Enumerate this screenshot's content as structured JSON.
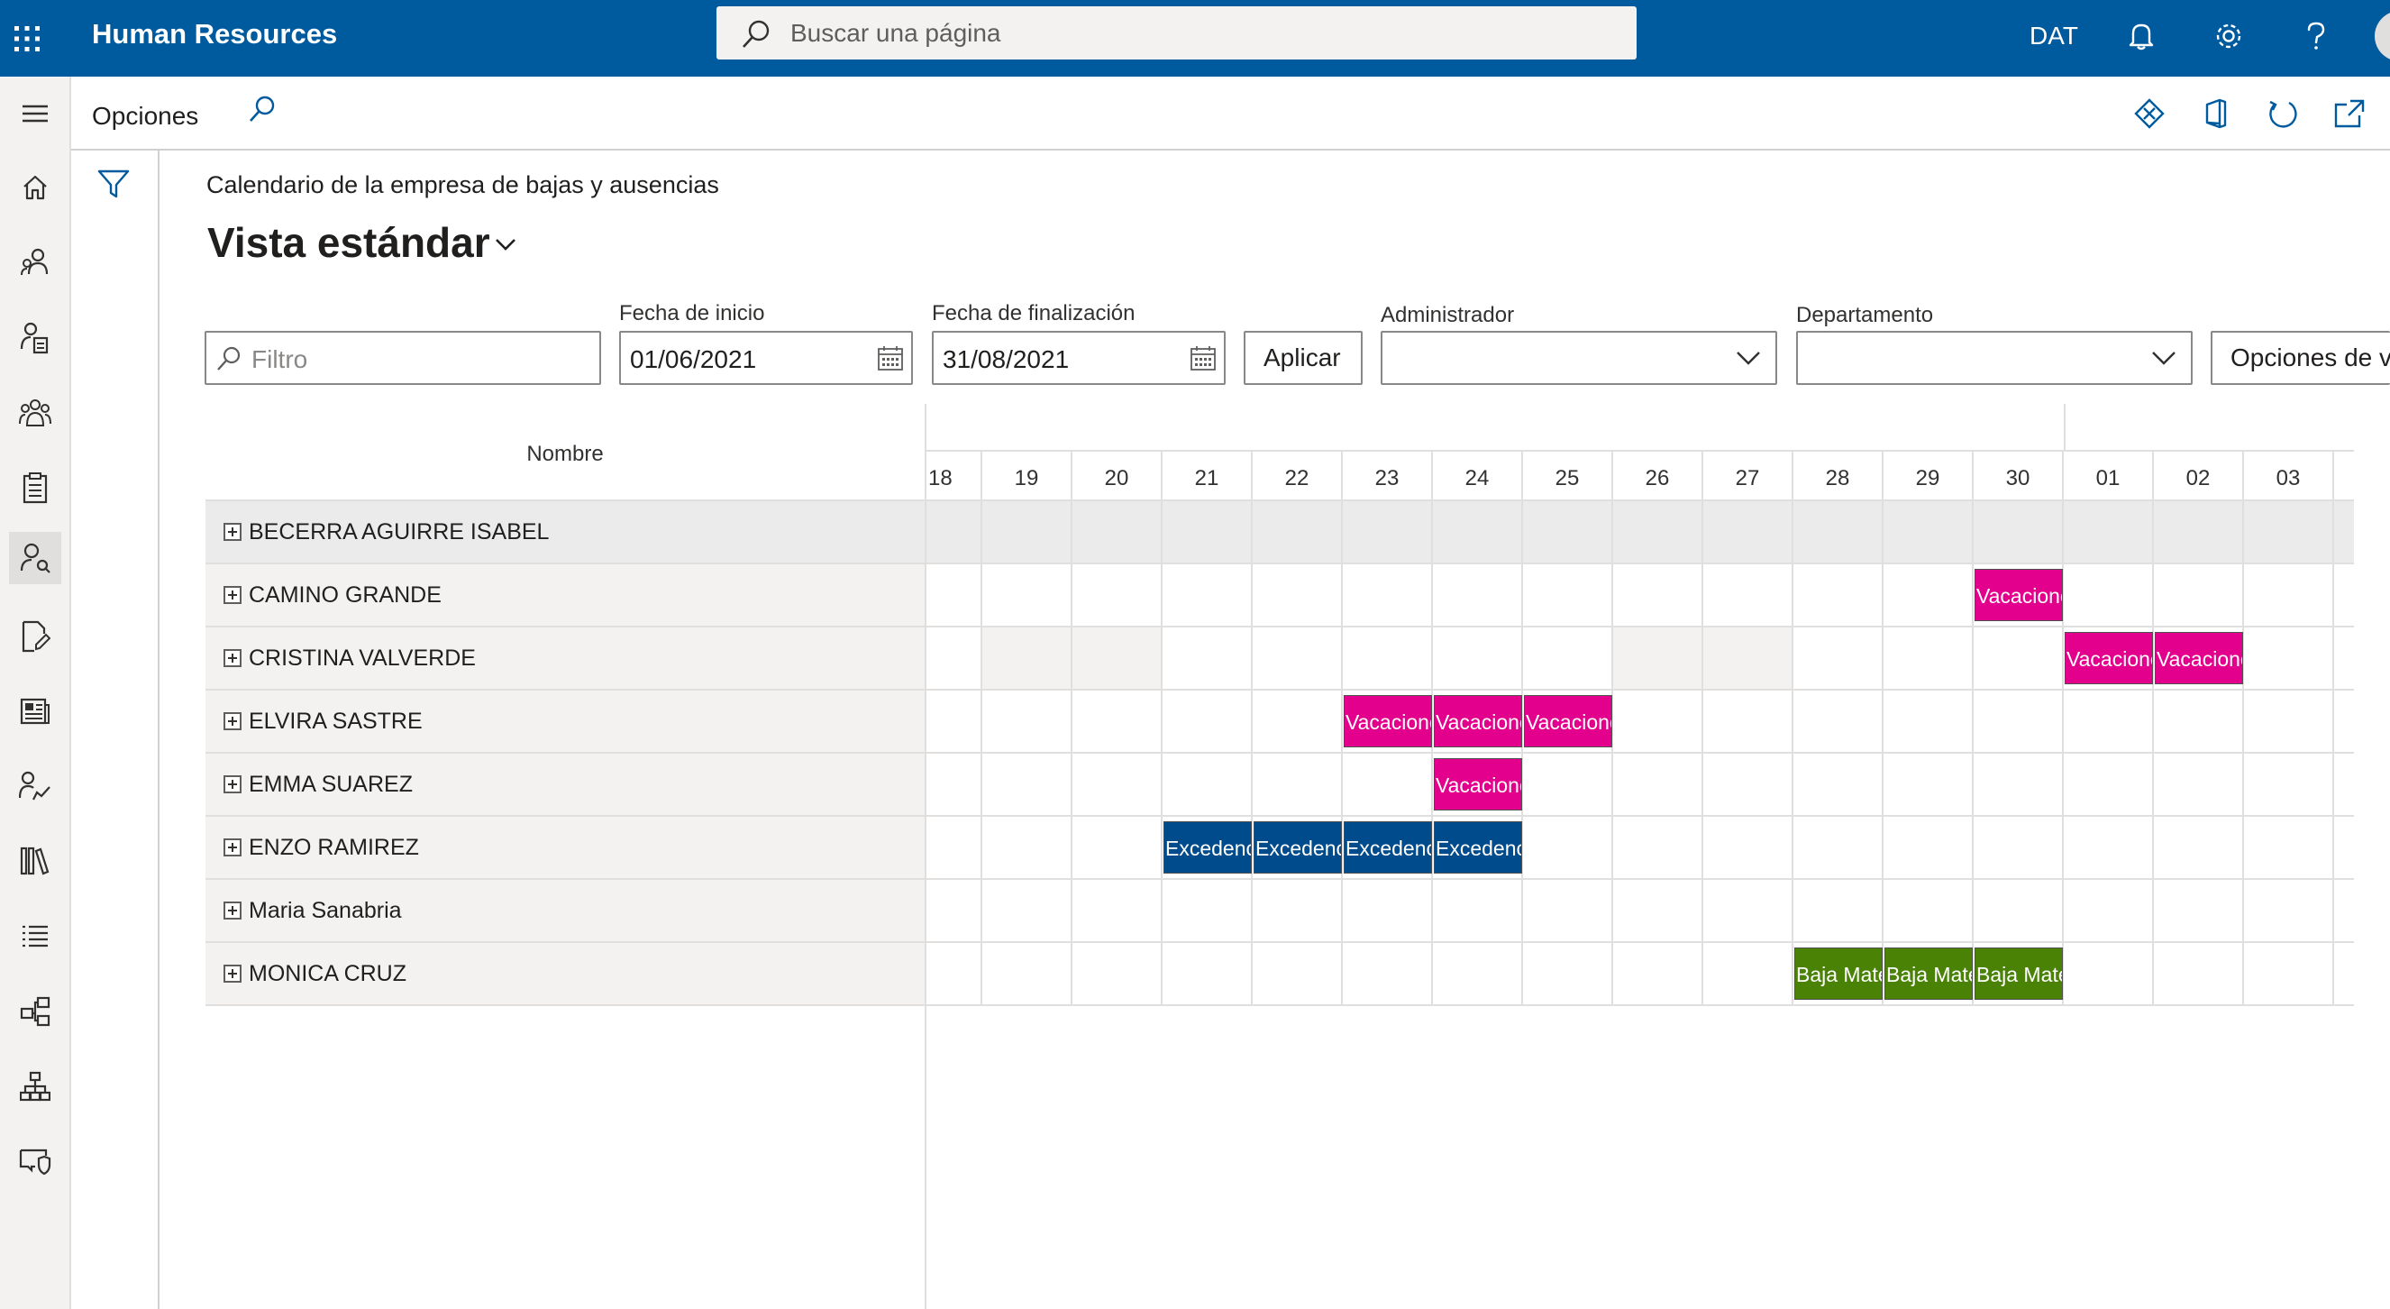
{
  "app": {
    "title": "Human Resources",
    "search_placeholder": "Buscar una página",
    "company": "DAT"
  },
  "actionbar": {
    "label": "Opciones"
  },
  "page": {
    "caption": "Calendario de la empresa de bajas y ausencias",
    "view_title": "Vista estándar"
  },
  "filters": {
    "filter_placeholder": "Filtro",
    "start_label": "Fecha de inicio",
    "start_value": "01/06/2021",
    "end_label": "Fecha de finalización",
    "end_value": "31/08/2021",
    "apply_label": "Aplicar",
    "manager_label": "Administrador",
    "manager_value": "",
    "department_label": "Departamento",
    "department_value": "",
    "options_label": "Opciones de v"
  },
  "calendar": {
    "name_header": "Nombre",
    "days": [
      "18",
      "19",
      "20",
      "21",
      "22",
      "23",
      "24",
      "25",
      "26",
      "27",
      "28",
      "29",
      "30",
      "01",
      "02",
      "03"
    ],
    "rows": [
      {
        "name": "BECERRA AGUIRRE ISABEL",
        "events": []
      },
      {
        "name": "CAMINO GRANDE",
        "events": [
          {
            "day_index": 12,
            "label": "Vacaciones",
            "type": "vac"
          }
        ]
      },
      {
        "name": "CRISTINA VALVERDE",
        "events": [
          {
            "day_index": 13,
            "label": "Vacaciones",
            "type": "vac"
          },
          {
            "day_index": 14,
            "label": "Vacaciones",
            "type": "vac"
          }
        ]
      },
      {
        "name": "ELVIRA SASTRE",
        "events": [
          {
            "day_index": 5,
            "label": "Vacaciones",
            "type": "vac"
          },
          {
            "day_index": 6,
            "label": "Vacaciones",
            "type": "vac"
          },
          {
            "day_index": 7,
            "label": "Vacaciones",
            "type": "vac"
          }
        ]
      },
      {
        "name": "EMMA SUAREZ",
        "events": [
          {
            "day_index": 6,
            "label": "Vacaciones",
            "type": "vac"
          }
        ]
      },
      {
        "name": "ENZO RAMIREZ",
        "events": [
          {
            "day_index": 3,
            "label": "Excedencia",
            "type": "exc"
          },
          {
            "day_index": 4,
            "label": "Excedencia",
            "type": "exc"
          },
          {
            "day_index": 5,
            "label": "Excedencia",
            "type": "exc"
          },
          {
            "day_index": 6,
            "label": "Excedencia",
            "type": "exc"
          }
        ]
      },
      {
        "name": "Maria Sanabria",
        "events": []
      },
      {
        "name": "MONICA CRUZ",
        "events": [
          {
            "day_index": 10,
            "label": "Baja Maternidad",
            "type": "mat"
          },
          {
            "day_index": 11,
            "label": "Baja Maternidad",
            "type": "mat"
          },
          {
            "day_index": 12,
            "label": "Baja Maternidad",
            "type": "mat"
          }
        ]
      }
    ]
  },
  "colors": {
    "topbar": "#005a9e",
    "vacaciones": "#e3008c",
    "excedencia": "#004b8b",
    "baja_maternidad": "#498205"
  },
  "icons": {
    "top": [
      "waffle-icon",
      "search-icon",
      "bell-icon",
      "gear-icon",
      "help-icon",
      "avatar"
    ],
    "nav": [
      "hamburger-icon",
      "home-icon",
      "people-icon",
      "person-document-icon",
      "team-icon",
      "clipboard-icon",
      "person-settings-icon",
      "document-edit-icon",
      "news-icon",
      "person-chart-icon",
      "library-icon",
      "list-icon",
      "workflow-icon",
      "org-chart-icon",
      "shield-message-icon"
    ],
    "actionbar": [
      "find-icon",
      "diamond-icon",
      "office-icon",
      "refresh-icon",
      "open-new-icon"
    ]
  }
}
